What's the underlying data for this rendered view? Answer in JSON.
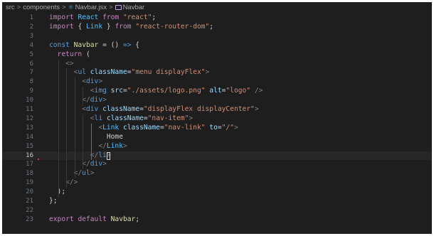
{
  "breadcrumb": {
    "items": [
      "src",
      "components",
      "Navbar.jsx",
      "Navbar"
    ],
    "separator": ">"
  },
  "editor": {
    "active_line": 16,
    "lines": [
      {
        "n": "1",
        "tokens": [
          {
            "t": "import ",
            "c": "t-kw"
          },
          {
            "t": "React",
            "c": "t-var"
          },
          {
            "t": " from ",
            "c": "t-kw"
          },
          {
            "t": "\"react\"",
            "c": "t-str"
          },
          {
            "t": ";",
            "c": "t-txt"
          }
        ]
      },
      {
        "n": "2",
        "tokens": [
          {
            "t": "import ",
            "c": "t-kw"
          },
          {
            "t": "{ ",
            "c": "t-txt"
          },
          {
            "t": "Link",
            "c": "t-var"
          },
          {
            "t": " } ",
            "c": "t-txt"
          },
          {
            "t": "from ",
            "c": "t-kw"
          },
          {
            "t": "\"react-router-dom\"",
            "c": "t-str"
          },
          {
            "t": ";",
            "c": "t-txt"
          }
        ]
      },
      {
        "n": "3",
        "tokens": []
      },
      {
        "n": "4",
        "tokens": [
          {
            "t": "const ",
            "c": "t-storage"
          },
          {
            "t": "Navbar",
            "c": "t-fn"
          },
          {
            "t": " = () ",
            "c": "t-txt"
          },
          {
            "t": "=>",
            "c": "t-storage"
          },
          {
            "t": " {",
            "c": "t-txt"
          }
        ]
      },
      {
        "n": "5",
        "tokens": [
          {
            "t": "  return",
            "c": "t-kw"
          },
          {
            "t": " (",
            "c": "t-txt"
          }
        ]
      },
      {
        "n": "6",
        "tokens": [
          {
            "t": "    ",
            "c": "t-txt"
          },
          {
            "t": "<>",
            "c": "t-punc"
          }
        ]
      },
      {
        "n": "7",
        "tokens": [
          {
            "t": "      ",
            "c": "t-txt"
          },
          {
            "t": "<",
            "c": "t-punc"
          },
          {
            "t": "ul",
            "c": "t-tag"
          },
          {
            "t": " className",
            "c": "t-attr"
          },
          {
            "t": "=",
            "c": "t-txt"
          },
          {
            "t": "\"menu displayFlex\"",
            "c": "t-str"
          },
          {
            "t": ">",
            "c": "t-punc"
          }
        ]
      },
      {
        "n": "8",
        "tokens": [
          {
            "t": "        ",
            "c": "t-txt"
          },
          {
            "t": "<",
            "c": "t-punc"
          },
          {
            "t": "div",
            "c": "t-tag"
          },
          {
            "t": ">",
            "c": "t-punc"
          }
        ]
      },
      {
        "n": "9",
        "tokens": [
          {
            "t": "          ",
            "c": "t-txt"
          },
          {
            "t": "<",
            "c": "t-punc"
          },
          {
            "t": "img",
            "c": "t-tag"
          },
          {
            "t": " src",
            "c": "t-attr"
          },
          {
            "t": "=",
            "c": "t-txt"
          },
          {
            "t": "\"./assets/logo.png\"",
            "c": "t-str"
          },
          {
            "t": " alt",
            "c": "t-attr"
          },
          {
            "t": "=",
            "c": "t-txt"
          },
          {
            "t": "\"logo\"",
            "c": "t-str"
          },
          {
            "t": " />",
            "c": "t-punc"
          }
        ]
      },
      {
        "n": "10",
        "tokens": [
          {
            "t": "        ",
            "c": "t-txt"
          },
          {
            "t": "</",
            "c": "t-punc"
          },
          {
            "t": "div",
            "c": "t-tag"
          },
          {
            "t": ">",
            "c": "t-punc"
          }
        ]
      },
      {
        "n": "11",
        "tokens": [
          {
            "t": "        ",
            "c": "t-txt"
          },
          {
            "t": "<",
            "c": "t-punc"
          },
          {
            "t": "div",
            "c": "t-tag"
          },
          {
            "t": " className",
            "c": "t-attr"
          },
          {
            "t": "=",
            "c": "t-txt"
          },
          {
            "t": "\"displayFlex displayCenter\"",
            "c": "t-str"
          },
          {
            "t": ">",
            "c": "t-punc"
          }
        ]
      },
      {
        "n": "12",
        "tokens": [
          {
            "t": "          ",
            "c": "t-txt"
          },
          {
            "t": "<",
            "c": "t-punc"
          },
          {
            "t": "li",
            "c": "t-tag"
          },
          {
            "t": " className",
            "c": "t-attr"
          },
          {
            "t": "=",
            "c": "t-txt"
          },
          {
            "t": "\"nav-item\"",
            "c": "t-str"
          },
          {
            "t": ">",
            "c": "t-punc"
          }
        ]
      },
      {
        "n": "13",
        "tokens": [
          {
            "t": "            ",
            "c": "t-txt"
          },
          {
            "t": "<",
            "c": "t-punc"
          },
          {
            "t": "Link",
            "c": "t-var"
          },
          {
            "t": " className",
            "c": "t-attr"
          },
          {
            "t": "=",
            "c": "t-txt"
          },
          {
            "t": "\"nav-link\"",
            "c": "t-str"
          },
          {
            "t": " to",
            "c": "t-attr"
          },
          {
            "t": "=",
            "c": "t-txt"
          },
          {
            "t": "\"/\"",
            "c": "t-str"
          },
          {
            "t": ">",
            "c": "t-punc"
          }
        ]
      },
      {
        "n": "14",
        "tokens": [
          {
            "t": "              ",
            "c": "t-txt"
          },
          {
            "t": "Home",
            "c": "t-txt"
          }
        ]
      },
      {
        "n": "15",
        "tokens": [
          {
            "t": "            ",
            "c": "t-txt"
          },
          {
            "t": "</",
            "c": "t-punc"
          },
          {
            "t": "Link",
            "c": "t-var"
          },
          {
            "t": ">",
            "c": "t-punc"
          }
        ]
      },
      {
        "n": "16",
        "tokens": [
          {
            "t": "          ",
            "c": "t-txt"
          },
          {
            "t": "</",
            "c": "t-punc"
          },
          {
            "t": "li",
            "c": "t-tag"
          },
          {
            "t": ">",
            "c": "t-punc"
          }
        ]
      },
      {
        "n": "17",
        "tokens": [
          {
            "t": "        ",
            "c": "t-txt"
          },
          {
            "t": "</",
            "c": "t-punc"
          },
          {
            "t": "div",
            "c": "t-tag"
          },
          {
            "t": ">",
            "c": "t-punc"
          }
        ]
      },
      {
        "n": "18",
        "tokens": [
          {
            "t": "      ",
            "c": "t-txt"
          },
          {
            "t": "</",
            "c": "t-punc"
          },
          {
            "t": "ul",
            "c": "t-tag"
          },
          {
            "t": ">",
            "c": "t-punc"
          }
        ]
      },
      {
        "n": "19",
        "tokens": [
          {
            "t": "    ",
            "c": "t-txt"
          },
          {
            "t": "</>",
            "c": "t-punc"
          }
        ]
      },
      {
        "n": "20",
        "tokens": [
          {
            "t": "  );",
            "c": "t-txt"
          }
        ]
      },
      {
        "n": "21",
        "tokens": [
          {
            "t": "};",
            "c": "t-txt"
          }
        ]
      },
      {
        "n": "22",
        "tokens": []
      },
      {
        "n": "23",
        "tokens": [
          {
            "t": "export ",
            "c": "t-kw"
          },
          {
            "t": "default ",
            "c": "t-kw"
          },
          {
            "t": "Navbar",
            "c": "t-fn"
          },
          {
            "t": ";",
            "c": "t-txt"
          }
        ]
      }
    ]
  }
}
